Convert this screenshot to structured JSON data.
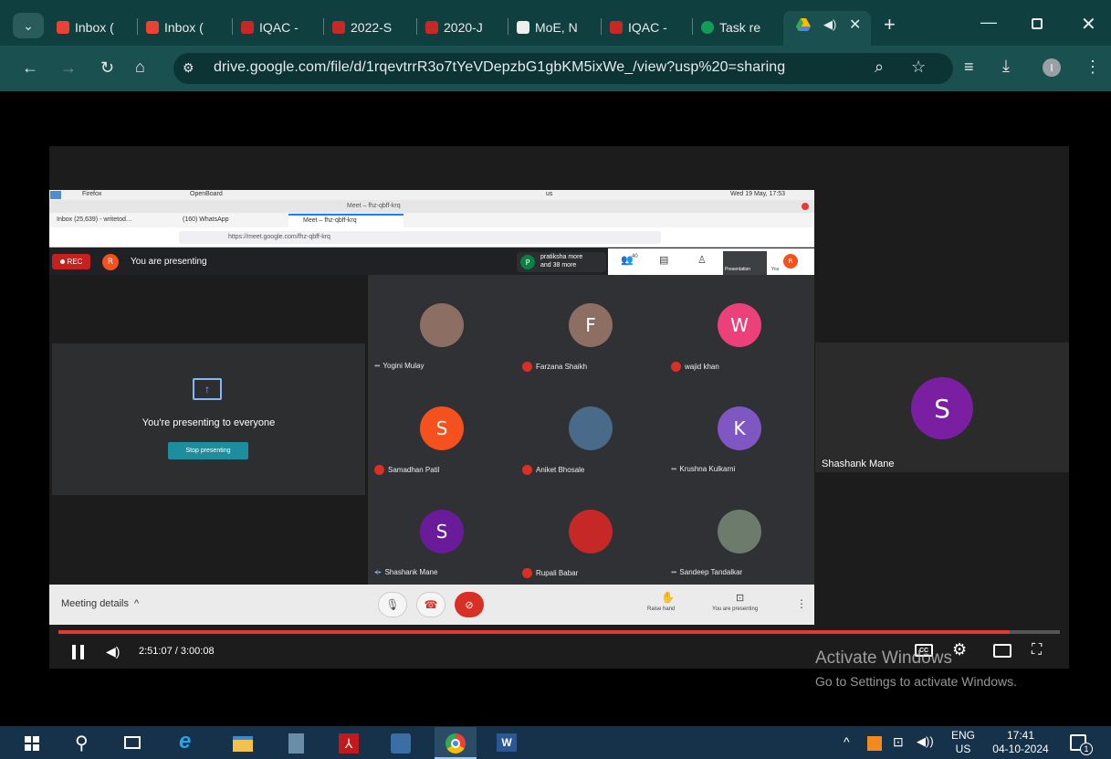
{
  "browser": {
    "tabs": [
      {
        "label": "Inbox (",
        "icon": "gmail-icon"
      },
      {
        "label": "Inbox (",
        "icon": "gmail-icon"
      },
      {
        "label": "IQAC -",
        "icon": "pdf-icon"
      },
      {
        "label": "2022-S",
        "icon": "pdf-icon"
      },
      {
        "label": "2020-J",
        "icon": "pdf-icon"
      },
      {
        "label": "MoE, N",
        "icon": "doc-icon"
      },
      {
        "label": "IQAC -",
        "icon": "pdf-icon"
      },
      {
        "label": "Task re",
        "icon": "sheets-icon"
      }
    ],
    "address": "drive.google.com/file/d/1rqevtrrR3o7tYeVDepzbG1gbKM5ixWe_/view?usp%20=sharing",
    "profile_initial": "I"
  },
  "meet": {
    "os_bar": {
      "firefox": "Firefox",
      "openboard": "OpenBoard",
      "lang": "us",
      "datetime": "Wed 19 May, 17:53"
    },
    "window_title": "Meet – fhz-qbff-krq",
    "tabs": [
      "Inbox (25,639) - writetod…",
      "(160) WhatsApp",
      "Meet – fhz-qbff-krq"
    ],
    "url": "https://meet.google.com/fhz-qbff-krq",
    "rec": "REC",
    "presenting_label": "You are presenting",
    "self_initial": "R",
    "participants_chip": {
      "initial": "P",
      "line1": "pratiksha more",
      "line2": "and 38 more"
    },
    "participant_count": "40",
    "presentation_label": "Presentation",
    "you_label": "You",
    "present_panel": {
      "title": "You're presenting to everyone",
      "button": "Stop presenting"
    },
    "tiles": [
      {
        "name": "Yogini Mulay",
        "initial": "",
        "color": "#8d6e63",
        "status": "dots"
      },
      {
        "name": "Farzana Shaikh",
        "initial": "F",
        "color": "#8d6e63",
        "status": "mic-off"
      },
      {
        "name": "wajid khan",
        "initial": "W",
        "color": "#ec407a",
        "status": "mic-off"
      },
      {
        "name": "Samadhan Patil",
        "initial": "S",
        "color": "#f4511e",
        "status": "mic-off"
      },
      {
        "name": "Aniket Bhosale",
        "initial": "",
        "color": "#4a6a8a",
        "status": "mic-off"
      },
      {
        "name": "Krushna Kulkarni",
        "initial": "K",
        "color": "#7e57c2",
        "status": "dots"
      },
      {
        "name": "Shashank Mane",
        "initial": "S",
        "color": "#6a1b9a",
        "status": "speaking"
      },
      {
        "name": "Rupali Babar",
        "initial": "",
        "color": "#c62828",
        "status": "mic-off"
      },
      {
        "name": "Sandeep Tandalkar",
        "initial": "",
        "color": "#6d7b6d",
        "status": "dots"
      }
    ],
    "bottom": {
      "meeting_details": "Meeting details",
      "raise_hand": "Raise hand",
      "you_are_presenting": "You are presenting"
    }
  },
  "side_tile": {
    "initial": "S",
    "name": "Shashank Mane"
  },
  "player": {
    "time": "2:51:07 / 3:00:08",
    "progress": 0.95
  },
  "watermark": {
    "line1": "Activate Windows",
    "line2": "Go to Settings to activate Windows."
  },
  "taskbar": {
    "lang1": "ENG",
    "lang2": "US",
    "time": "17:41",
    "date": "04-10-2024",
    "notif": "1"
  }
}
